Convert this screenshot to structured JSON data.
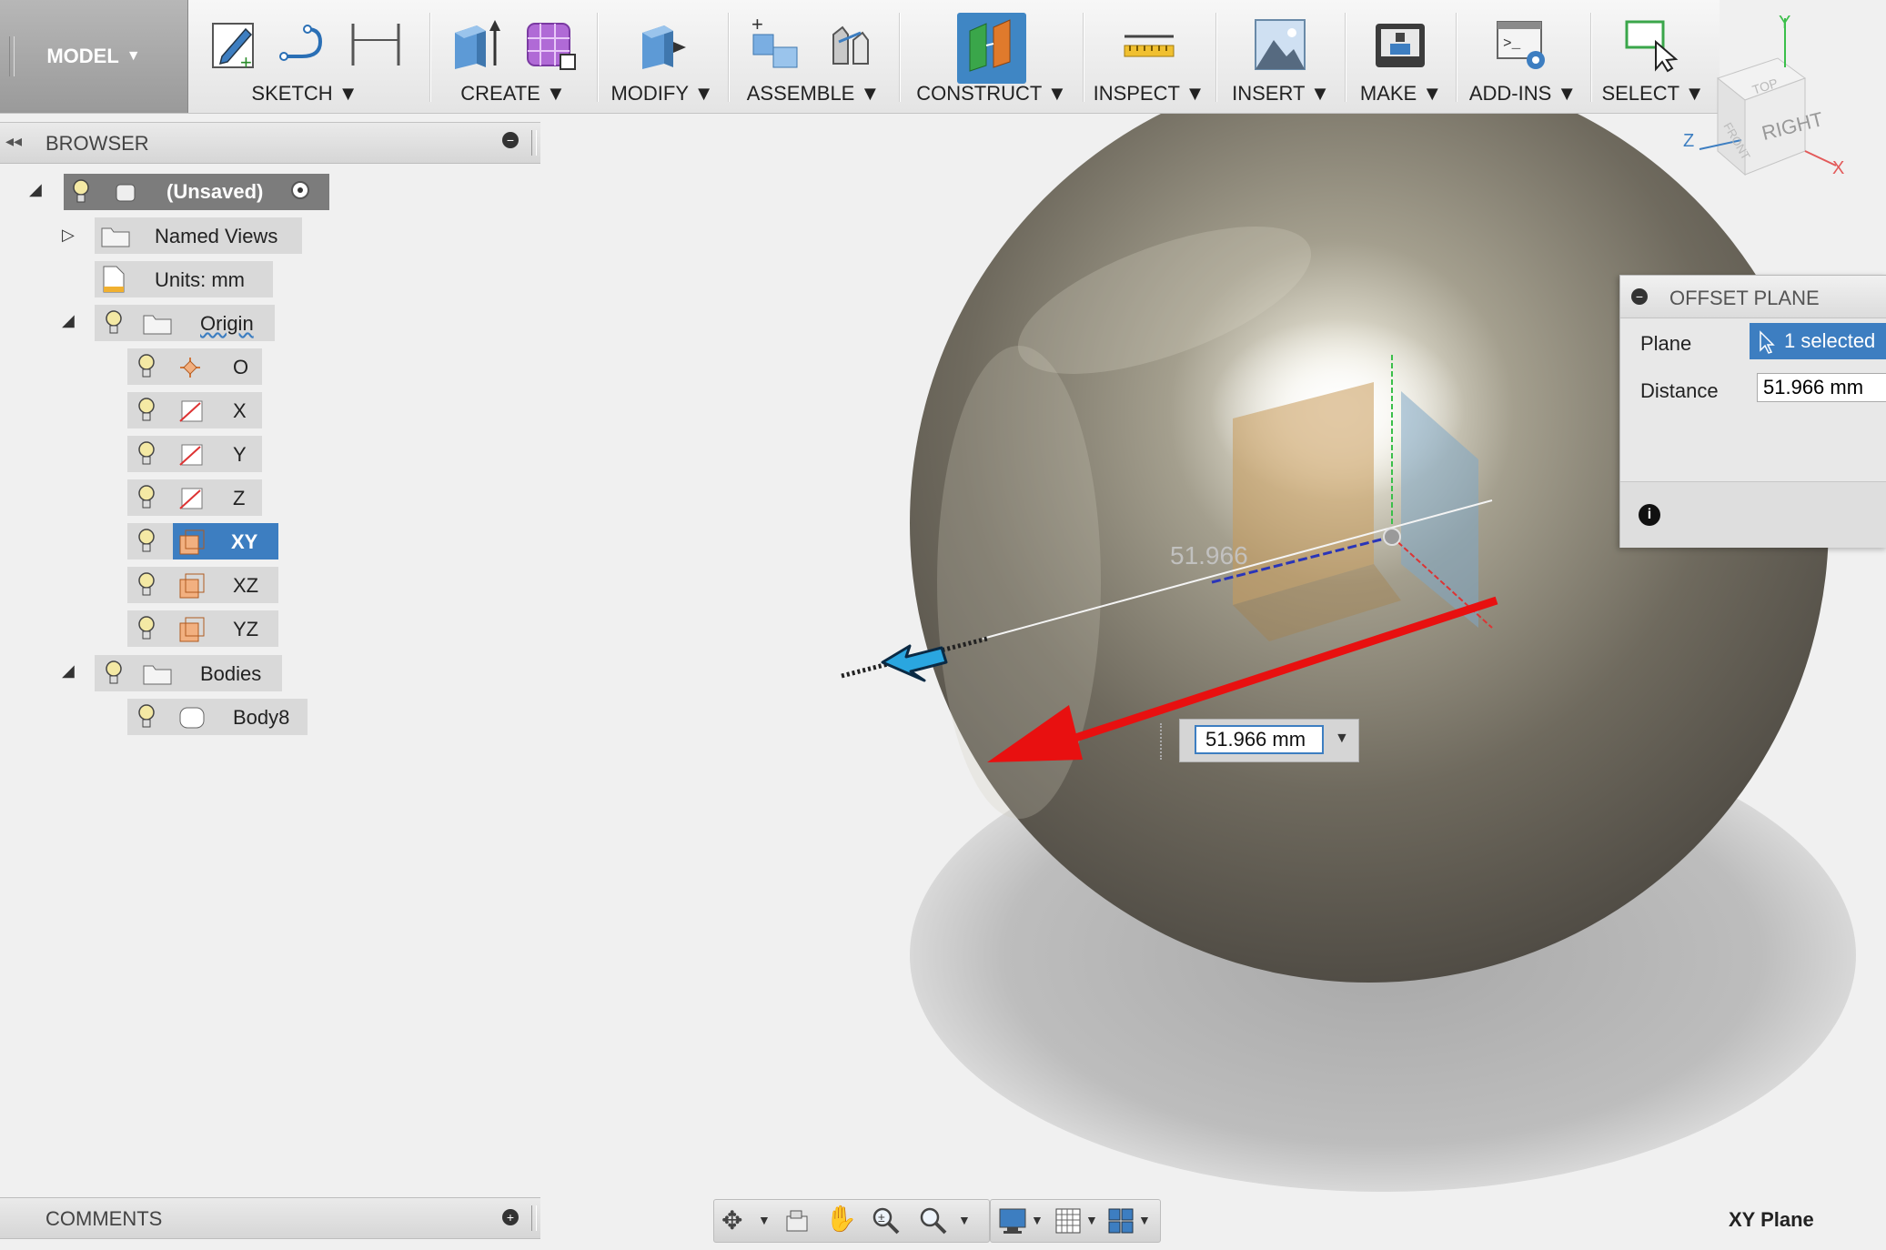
{
  "toolbar": {
    "workspace": "MODEL",
    "groups": {
      "sketch": "SKETCH",
      "create": "CREATE",
      "modify": "MODIFY",
      "assemble": "ASSEMBLE",
      "construct": "CONSTRUCT",
      "inspect": "INSPECT",
      "insert": "INSERT",
      "make": "MAKE",
      "addins": "ADD-INS",
      "select": "SELECT"
    }
  },
  "viewcube": {
    "face": "RIGHT",
    "axis_y": "Y",
    "axis_z": "Z",
    "axis_x": "X"
  },
  "browser": {
    "title": "BROWSER",
    "root": "(Unsaved)",
    "items": {
      "named_views": "Named Views",
      "units": "Units: mm",
      "origin": "Origin",
      "o": "O",
      "x": "X",
      "y": "Y",
      "z": "Z",
      "xy": "XY",
      "xz": "XZ",
      "yz": "YZ",
      "bodies": "Bodies",
      "body8": "Body8"
    }
  },
  "comments": {
    "title": "COMMENTS"
  },
  "dialog": {
    "title": "OFFSET PLANE",
    "plane_label": "Plane",
    "plane_value": "1 selected",
    "distance_label": "Distance",
    "distance_value": "51.966 mm"
  },
  "canvas": {
    "dimension_label": "51.966",
    "input_value": "51.966 mm"
  },
  "status": {
    "selection": "XY Plane"
  },
  "colors": {
    "accent": "#3d7ec1",
    "annotation_arrow": "#e81010",
    "manipulator": "#2aa6e0"
  }
}
